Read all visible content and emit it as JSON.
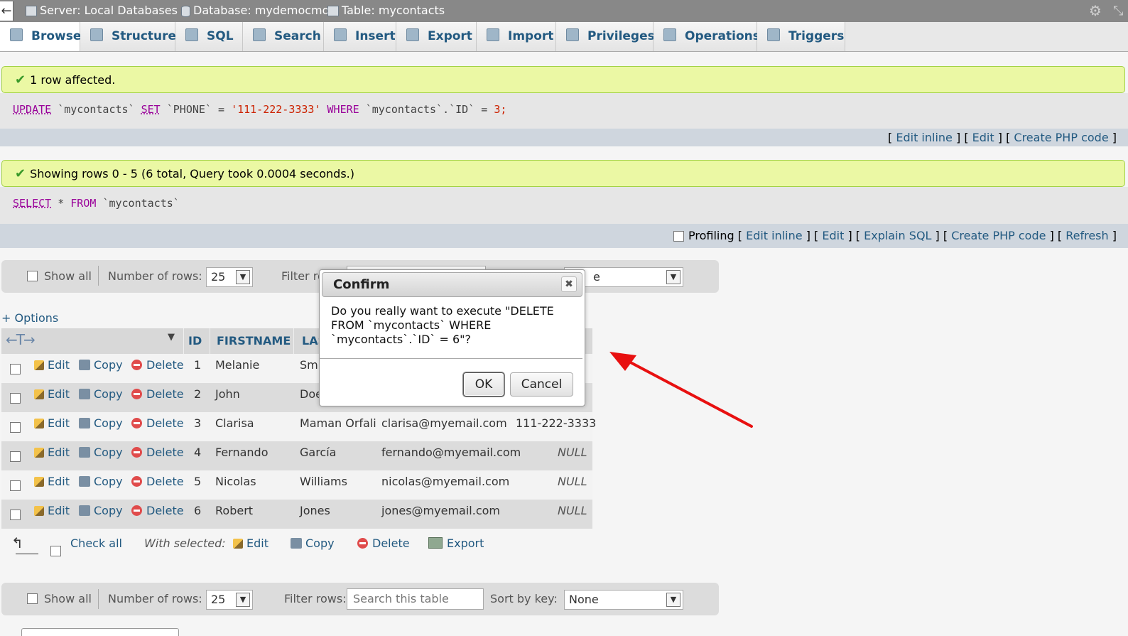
{
  "breadcrumb": {
    "back": "←",
    "server": "Server: Local Databases »",
    "database": "Database: mydemocmo »",
    "table": "Table: mycontacts"
  },
  "tabs": [
    {
      "label": "Browse",
      "icon": "browse-icon"
    },
    {
      "label": "Structure",
      "icon": "structure-icon"
    },
    {
      "label": "SQL",
      "icon": "sql-icon"
    },
    {
      "label": "Search",
      "icon": "search-icon"
    },
    {
      "label": "Insert",
      "icon": "insert-icon"
    },
    {
      "label": "Export",
      "icon": "export-icon"
    },
    {
      "label": "Import",
      "icon": "import-icon"
    },
    {
      "label": "Privileges",
      "icon": "privileges-icon"
    },
    {
      "label": "Operations",
      "icon": "operations-icon"
    },
    {
      "label": "Triggers",
      "icon": "triggers-icon"
    }
  ],
  "update_result": {
    "message": "1 row affected.",
    "sql": {
      "kw1": "UPDATE",
      "tbl": "`mycontacts`",
      "kw2": "SET",
      "col": "`PHONE`",
      "eq": "=",
      "val": "'111-222-3333'",
      "kw3": "WHERE",
      "cond": "`mycontacts`.`ID`",
      "eq2": "=",
      "num": "3;"
    },
    "links": {
      "open": "[",
      "edit_inline": "Edit inline",
      "sep1": "] [",
      "edit": "Edit",
      "sep2": "] [",
      "php": "Create PHP code",
      "close": "]"
    }
  },
  "select_result": {
    "message": "Showing rows 0 - 5 (6 total, Query took 0.0004 seconds.)",
    "sql": {
      "kw1": "SELECT",
      "star": "*",
      "kw2": "FROM",
      "tbl": "`mycontacts`"
    },
    "links": {
      "profiling": "Profiling",
      "open": "[",
      "edit_inline": "Edit inline",
      "sep1": "] [",
      "edit": "Edit",
      "sep2": "] [",
      "explain": "Explain SQL",
      "sep3": "] [",
      "php": "Create PHP code",
      "sep4": "] [",
      "refresh": "Refresh",
      "close": "]"
    }
  },
  "nav": {
    "show_all": "Show all",
    "number_of_rows_label": "Number of rows:",
    "rows_value": "25",
    "filter_label": "Filter rows:",
    "filter_label_partial": "Filter ro",
    "filter_placeholder": "Search this table",
    "sort_label": "Sort by key:",
    "sort_value": "None",
    "sort_value_partial": "e"
  },
  "options_link": "+ Options",
  "table": {
    "columns": [
      "ID",
      "FIRSTNAME",
      "LAS"
    ],
    "action_labels": {
      "edit": "Edit",
      "copy": "Copy",
      "delete": "Delete"
    },
    "rows": [
      {
        "id": "1",
        "first": "Melanie",
        "last": "Smi",
        "email": "",
        "phone": ""
      },
      {
        "id": "2",
        "first": "John",
        "last": "Doe",
        "email": "",
        "phone": ""
      },
      {
        "id": "3",
        "first": "Clarisa",
        "last": "Maman Orfali",
        "email": "clarisa@myemail.com",
        "phone": "111-222-3333"
      },
      {
        "id": "4",
        "first": "Fernando",
        "last": "García",
        "email": "fernando@myemail.com",
        "phone": "NULL"
      },
      {
        "id": "5",
        "first": "Nicolas",
        "last": "Williams",
        "email": "nicolas@myemail.com",
        "phone": "NULL"
      },
      {
        "id": "6",
        "first": "Robert",
        "last": "Jones",
        "email": "jones@myemail.com",
        "phone": "NULL"
      }
    ]
  },
  "bulk": {
    "check_all": "Check all",
    "with_selected": "With selected:",
    "edit": "Edit",
    "copy": "Copy",
    "delete": "Delete",
    "export": "Export"
  },
  "dialog": {
    "title": "Confirm",
    "close": "✖",
    "line1": "Do you really want to execute \"DELETE",
    "line2": "FROM `mycontacts` WHERE",
    "line3": "`mycontacts`.`ID` = 6\"?",
    "ok": "OK",
    "cancel": "Cancel"
  },
  "colors": {
    "accent_link": "#235a81",
    "success_bg": "#ebf8a4",
    "annotation_arrow": "#e81010"
  }
}
